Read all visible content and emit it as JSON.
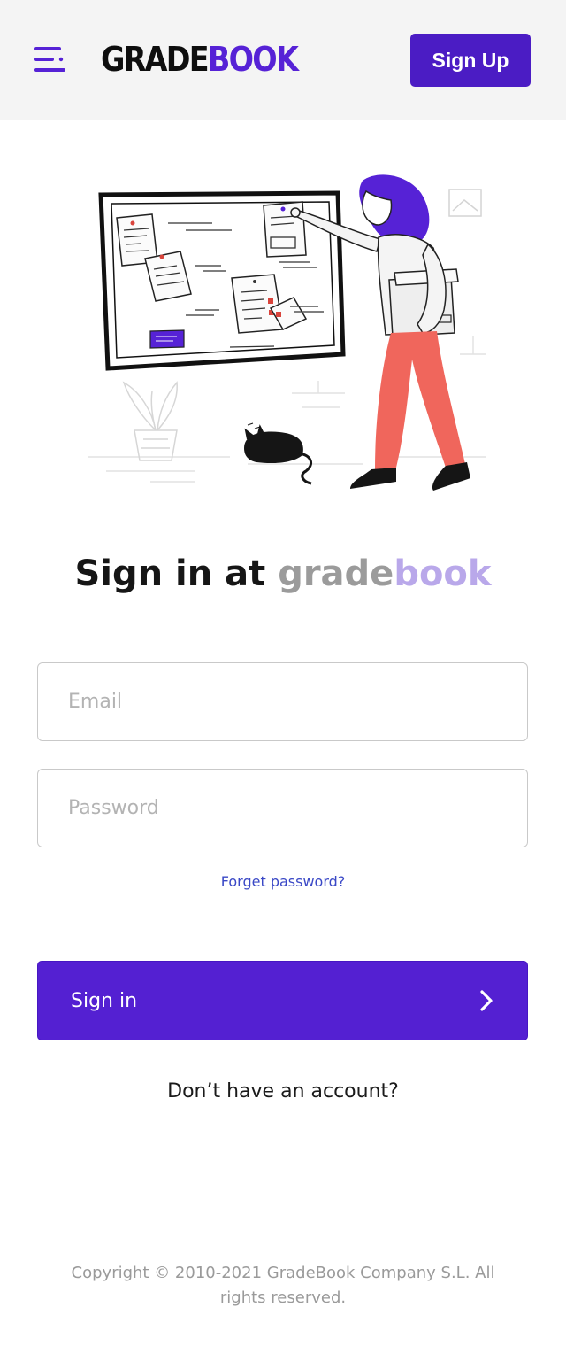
{
  "header": {
    "menu_icon": "menu-icon",
    "logo_part1": "GRADE",
    "logo_part2": "BOOK",
    "signup_label": "Sign Up",
    "colors": {
      "brand": "#5622d6",
      "button": "#4b1cc4"
    }
  },
  "main": {
    "title_prefix": "Sign in at ",
    "title_brand_part1": "grade",
    "title_brand_part2": "book",
    "email_placeholder": "Email",
    "email_value": "",
    "password_placeholder": "Password",
    "password_value": "",
    "forgot_label": "Forget password?",
    "signin_label": "Sign in",
    "signin_icon": "chevron-right-icon",
    "no_account_label": "Don’t have an account?"
  },
  "footer": {
    "copyright": "Copyright © 2010-2021 GradeBook Company S.L. All rights reserved."
  }
}
